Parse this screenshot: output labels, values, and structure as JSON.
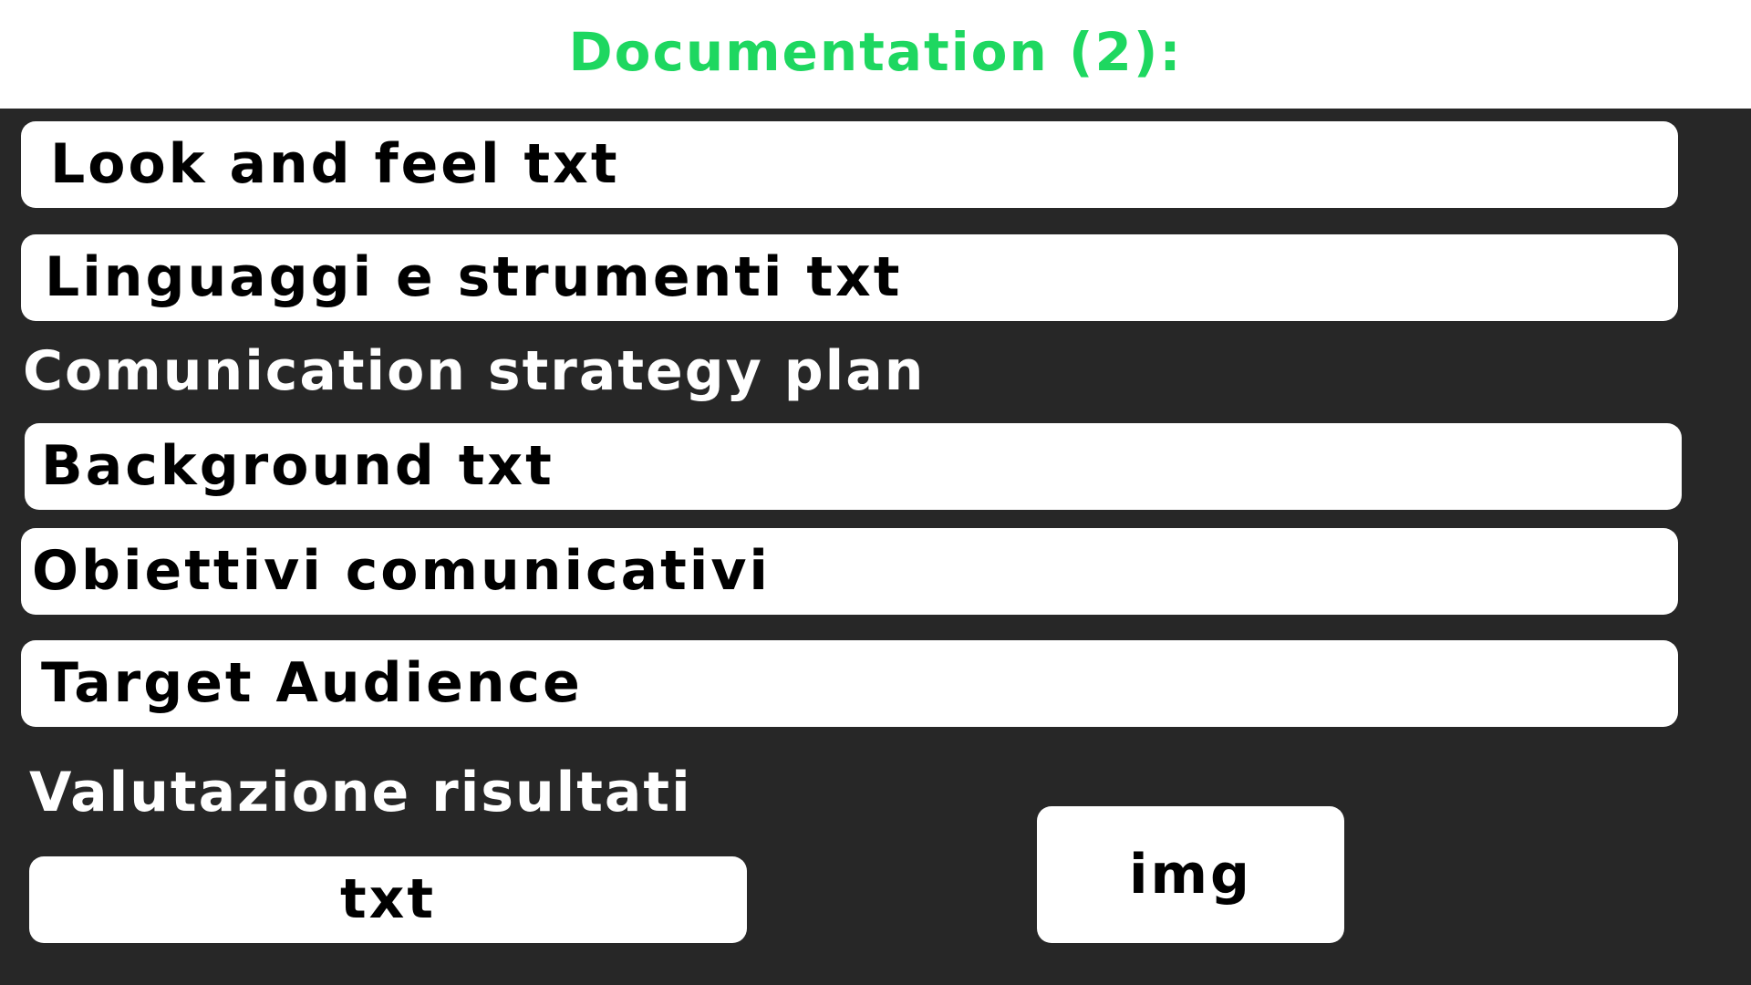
{
  "header": {
    "title": "Documentation (2):"
  },
  "colors": {
    "background": "#272727",
    "header_background": "#ffffff",
    "title": "#1ed760",
    "button_background": "#ffffff",
    "button_text": "#000000",
    "section_label": "#ffffff"
  },
  "items": {
    "look_and_feel": "Look and feel txt",
    "linguaggi": "Linguaggi e strumenti txt",
    "strategy_heading": "Comunication strategy plan",
    "background": "Background txt",
    "obiettivi": "Obiettivi comunicativi",
    "target": "Target Audience",
    "valutazione_heading": "Valutazione risultati",
    "txt_button": "txt",
    "img_button": "img"
  }
}
